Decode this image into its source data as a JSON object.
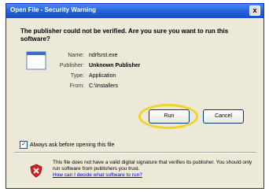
{
  "window": {
    "title": "Open File - Security Warning",
    "close_glyph": "x"
  },
  "dialog": {
    "question": "The publisher could not be verified. Are you sure you want to run this software?",
    "fields": [
      {
        "label": "Name:",
        "value": "ndrfsrst.exe",
        "bold": false
      },
      {
        "label": "Publisher:",
        "value": "Unknown Publisher",
        "bold": true
      },
      {
        "label": "Type:",
        "value": "Application",
        "bold": false
      },
      {
        "label": "From:",
        "value": "C:\\Installers",
        "bold": false
      }
    ]
  },
  "buttons": {
    "run_label": "Run",
    "cancel_label": "Cancel"
  },
  "checkbox": {
    "label": "Always ask before opening this file",
    "checked_glyph": "✓"
  },
  "warning": {
    "text": "This file does not have a valid digital signature that verifies its publisher. You should only run software from publishers you trust.",
    "link": "How can I decide what software to run?"
  },
  "colors": {
    "title_bar": "#2462de",
    "highlight": "#f2d32a",
    "shield_red": "#d21e1e"
  }
}
